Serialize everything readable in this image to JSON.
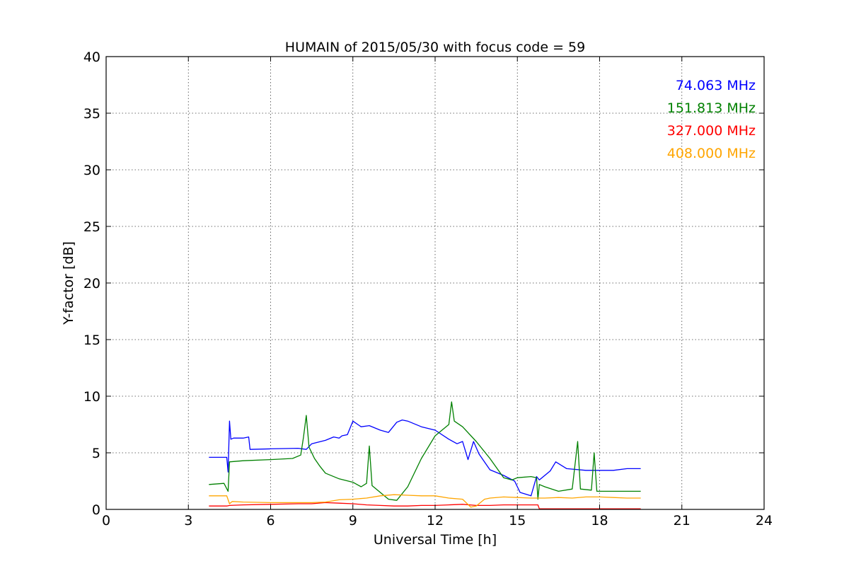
{
  "chart_data": {
    "type": "line",
    "title": "HUMAIN of 2015/05/30 with focus code = 59",
    "xlabel": "Universal Time [h]",
    "ylabel": "Y-factor [dB]",
    "xlim": [
      0,
      24
    ],
    "ylim": [
      0,
      40
    ],
    "xticks": [
      0,
      3,
      6,
      9,
      12,
      15,
      18,
      21,
      24
    ],
    "yticks": [
      0,
      5,
      10,
      15,
      20,
      25,
      30,
      35,
      40
    ],
    "grid": true,
    "legend_position": "top-right",
    "series": [
      {
        "name": "74.063 MHz",
        "color": "#0000ff",
        "points": [
          [
            3.75,
            4.6
          ],
          [
            4.4,
            4.6
          ],
          [
            4.45,
            3.3
          ],
          [
            4.5,
            7.8
          ],
          [
            4.55,
            6.2
          ],
          [
            4.65,
            6.3
          ],
          [
            5.0,
            6.3
          ],
          [
            5.2,
            6.4
          ],
          [
            5.25,
            5.3
          ],
          [
            6.0,
            5.35
          ],
          [
            7.0,
            5.4
          ],
          [
            7.3,
            5.3
          ],
          [
            7.5,
            5.8
          ],
          [
            8.0,
            6.1
          ],
          [
            8.3,
            6.4
          ],
          [
            8.5,
            6.3
          ],
          [
            8.6,
            6.5
          ],
          [
            8.8,
            6.6
          ],
          [
            9.0,
            7.8
          ],
          [
            9.3,
            7.3
          ],
          [
            9.6,
            7.4
          ],
          [
            10.0,
            7.0
          ],
          [
            10.3,
            6.8
          ],
          [
            10.6,
            7.7
          ],
          [
            10.8,
            7.9
          ],
          [
            11.0,
            7.8
          ],
          [
            11.5,
            7.3
          ],
          [
            12.0,
            7.0
          ],
          [
            12.5,
            6.2
          ],
          [
            12.8,
            5.8
          ],
          [
            13.0,
            6.0
          ],
          [
            13.2,
            4.4
          ],
          [
            13.4,
            6.0
          ],
          [
            13.6,
            4.9
          ],
          [
            14.0,
            3.5
          ],
          [
            14.5,
            3.0
          ],
          [
            14.9,
            2.5
          ],
          [
            15.1,
            1.5
          ],
          [
            15.5,
            1.2
          ],
          [
            15.7,
            2.9
          ],
          [
            15.8,
            2.6
          ],
          [
            16.2,
            3.4
          ],
          [
            16.4,
            4.2
          ],
          [
            16.8,
            3.6
          ],
          [
            17.5,
            3.45
          ],
          [
            18.0,
            3.45
          ],
          [
            18.5,
            3.45
          ],
          [
            19.0,
            3.6
          ],
          [
            19.5,
            3.6
          ]
        ]
      },
      {
        "name": "151.813 MHz",
        "color": "#008000",
        "points": [
          [
            3.75,
            2.2
          ],
          [
            4.3,
            2.3
          ],
          [
            4.45,
            1.6
          ],
          [
            4.5,
            4.2
          ],
          [
            5.0,
            4.3
          ],
          [
            6.0,
            4.4
          ],
          [
            6.8,
            4.5
          ],
          [
            7.1,
            4.8
          ],
          [
            7.2,
            6.4
          ],
          [
            7.3,
            8.3
          ],
          [
            7.4,
            5.5
          ],
          [
            7.6,
            4.5
          ],
          [
            7.8,
            3.8
          ],
          [
            8.0,
            3.2
          ],
          [
            8.5,
            2.7
          ],
          [
            9.0,
            2.4
          ],
          [
            9.3,
            2.0
          ],
          [
            9.5,
            2.3
          ],
          [
            9.6,
            5.6
          ],
          [
            9.7,
            2.1
          ],
          [
            10.0,
            1.5
          ],
          [
            10.3,
            0.9
          ],
          [
            10.6,
            0.8
          ],
          [
            11.0,
            2.0
          ],
          [
            11.5,
            4.5
          ],
          [
            12.0,
            6.5
          ],
          [
            12.5,
            7.5
          ],
          [
            12.6,
            9.5
          ],
          [
            12.7,
            7.8
          ],
          [
            13.0,
            7.3
          ],
          [
            13.5,
            6.0
          ],
          [
            14.0,
            4.5
          ],
          [
            14.5,
            2.8
          ],
          [
            14.8,
            2.6
          ],
          [
            15.0,
            2.8
          ],
          [
            15.5,
            2.9
          ],
          [
            15.7,
            2.8
          ],
          [
            15.75,
            0.9
          ],
          [
            15.8,
            2.2
          ],
          [
            16.0,
            2.0
          ],
          [
            16.5,
            1.6
          ],
          [
            17.0,
            1.8
          ],
          [
            17.2,
            6.0
          ],
          [
            17.3,
            1.8
          ],
          [
            17.7,
            1.7
          ],
          [
            17.8,
            5.0
          ],
          [
            17.9,
            1.6
          ],
          [
            18.5,
            1.6
          ],
          [
            19.0,
            1.6
          ],
          [
            19.5,
            1.6
          ]
        ]
      },
      {
        "name": "327.000 MHz",
        "color": "#ff0000",
        "points": [
          [
            3.75,
            0.3
          ],
          [
            4.4,
            0.3
          ],
          [
            4.5,
            0.35
          ],
          [
            5.0,
            0.4
          ],
          [
            6.0,
            0.45
          ],
          [
            7.0,
            0.5
          ],
          [
            7.5,
            0.5
          ],
          [
            8.0,
            0.6
          ],
          [
            8.5,
            0.55
          ],
          [
            9.0,
            0.5
          ],
          [
            9.5,
            0.4
          ],
          [
            10.0,
            0.35
          ],
          [
            10.5,
            0.3
          ],
          [
            11.0,
            0.3
          ],
          [
            11.5,
            0.35
          ],
          [
            12.0,
            0.35
          ],
          [
            12.5,
            0.4
          ],
          [
            13.0,
            0.45
          ],
          [
            13.5,
            0.35
          ],
          [
            14.0,
            0.35
          ],
          [
            14.5,
            0.4
          ],
          [
            15.0,
            0.4
          ],
          [
            15.5,
            0.4
          ],
          [
            15.75,
            0.4
          ],
          [
            15.8,
            0.05
          ],
          [
            16.5,
            0.05
          ],
          [
            17.5,
            0.05
          ],
          [
            18.5,
            0.05
          ],
          [
            19.5,
            0.05
          ]
        ]
      },
      {
        "name": "408.000 MHz",
        "color": "#ffa500",
        "points": [
          [
            3.75,
            1.2
          ],
          [
            4.4,
            1.2
          ],
          [
            4.5,
            0.5
          ],
          [
            4.6,
            0.7
          ],
          [
            5.0,
            0.65
          ],
          [
            6.0,
            0.6
          ],
          [
            7.0,
            0.6
          ],
          [
            7.5,
            0.6
          ],
          [
            8.0,
            0.65
          ],
          [
            8.5,
            0.85
          ],
          [
            9.0,
            0.9
          ],
          [
            9.5,
            1.0
          ],
          [
            10.0,
            1.2
          ],
          [
            10.5,
            1.3
          ],
          [
            11.0,
            1.25
          ],
          [
            11.5,
            1.2
          ],
          [
            12.0,
            1.2
          ],
          [
            12.5,
            1.0
          ],
          [
            13.0,
            0.9
          ],
          [
            13.3,
            0.2
          ],
          [
            13.5,
            0.3
          ],
          [
            13.8,
            0.9
          ],
          [
            14.0,
            1.0
          ],
          [
            14.5,
            1.1
          ],
          [
            15.0,
            1.05
          ],
          [
            15.5,
            1.0
          ],
          [
            16.0,
            1.0
          ],
          [
            16.5,
            1.05
          ],
          [
            17.0,
            1.0
          ],
          [
            17.5,
            1.1
          ],
          [
            18.0,
            1.1
          ],
          [
            18.5,
            1.05
          ],
          [
            19.0,
            1.0
          ],
          [
            19.5,
            1.0
          ]
        ]
      }
    ]
  }
}
